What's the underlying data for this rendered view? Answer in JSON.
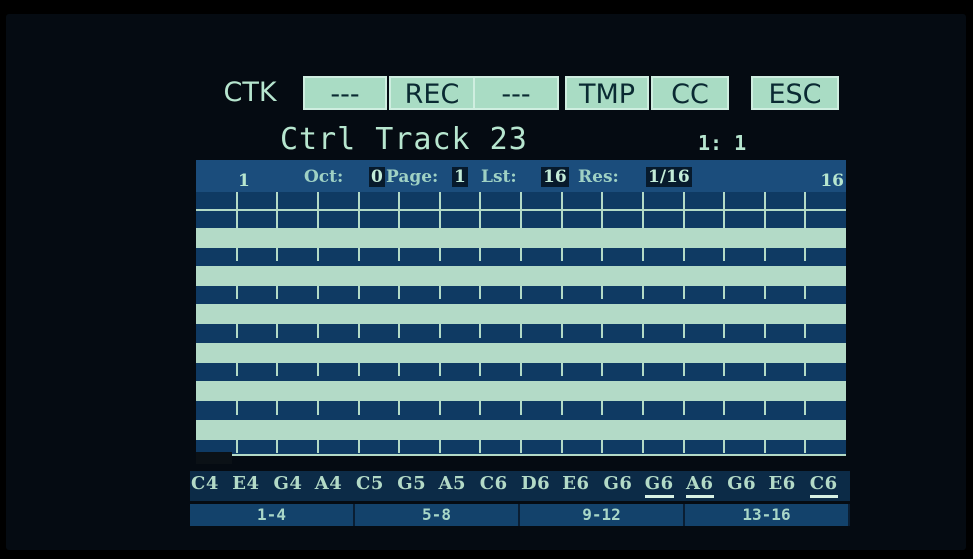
{
  "toolbar": {
    "items": [
      {
        "label": "CTK",
        "style": "plain"
      },
      {
        "label": "---",
        "style": "box"
      },
      {
        "label": "REC",
        "style": "box"
      },
      {
        "label": "---",
        "style": "box"
      },
      {
        "label": "TMP",
        "style": "box"
      },
      {
        "label": "CC",
        "style": "box"
      },
      {
        "label": "ESC",
        "style": "box"
      }
    ]
  },
  "header": {
    "title": "Ctrl Track 23",
    "position": "1: 1"
  },
  "info": {
    "first_step": "1",
    "last_step": "16",
    "oct_label": "Oct:",
    "oct_value": "0",
    "page_label": "Page:",
    "page_value": "1",
    "lst_label": "Lst:",
    "lst_value": "16",
    "res_label": "Res:",
    "res_value": "1/16"
  },
  "notes": [
    "C4",
    "E4",
    "G4",
    "A4",
    "C5",
    "G5",
    "A5",
    "C6",
    "D6",
    "E6",
    "G6",
    "G6",
    "A6",
    "G6",
    "E6",
    "C6"
  ],
  "selected_notes": [
    11,
    12,
    15
  ],
  "pages": [
    "1-4",
    "5-8",
    "9-12",
    "13-16"
  ],
  "colors": {
    "screen_bg": "#050b12",
    "grid_bg": "#0f3a63",
    "grid_line": "#b3dac7",
    "text": "#b7e6cf"
  }
}
